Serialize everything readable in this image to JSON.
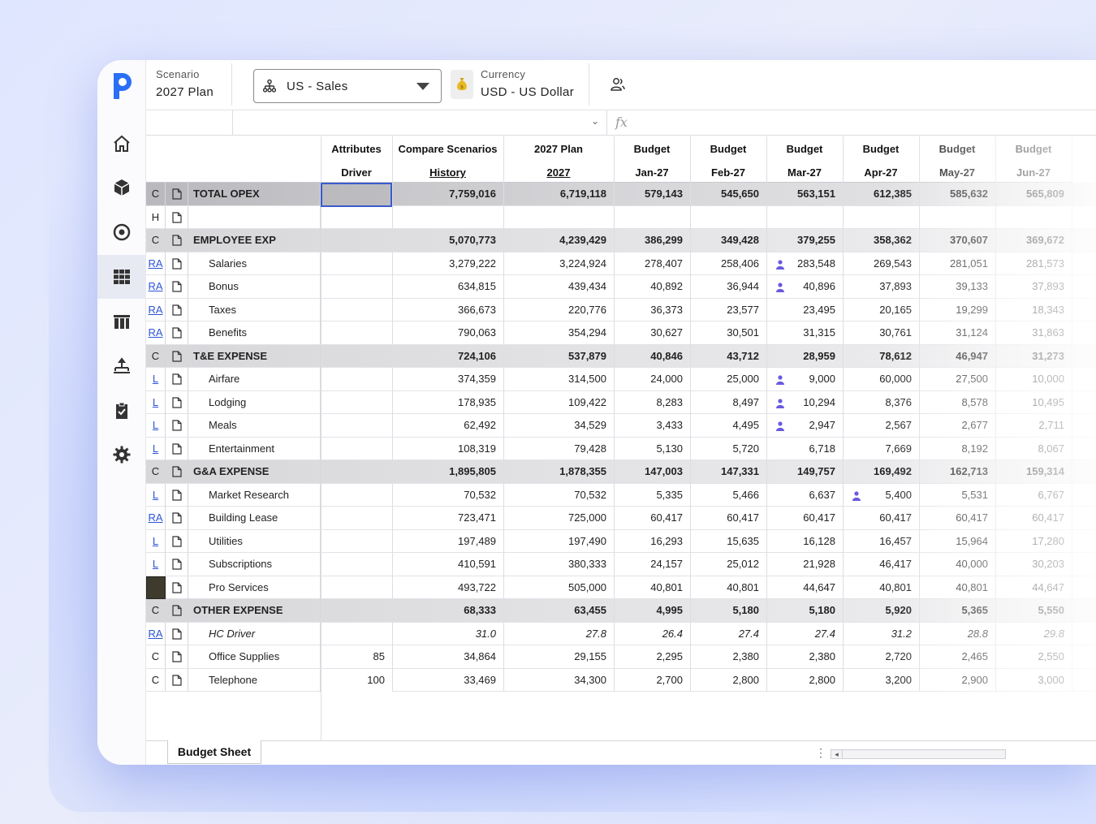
{
  "header": {
    "scenario_label": "Scenario",
    "scenario_value": "2027 Plan",
    "department_value": "US - Sales",
    "currency_label": "Currency",
    "currency_value": "USD - US Dollar"
  },
  "sheet_tab": "Budget Sheet",
  "columns": [
    {
      "top": "Attributes",
      "bottom": "Driver",
      "underline": false
    },
    {
      "top": "Compare Scenarios",
      "bottom": "History",
      "underline": true
    },
    {
      "top": "2027 Plan",
      "bottom": "2027",
      "underline": true
    },
    {
      "top": "Budget",
      "bottom": "Jan-27",
      "underline": false
    },
    {
      "top": "Budget",
      "bottom": "Feb-27",
      "underline": false
    },
    {
      "top": "Budget",
      "bottom": "Mar-27",
      "underline": false
    },
    {
      "top": "Budget",
      "bottom": "Apr-27",
      "underline": false
    },
    {
      "top": "Budget",
      "bottom": "May-27",
      "underline": false
    },
    {
      "top": "Budget",
      "bottom": "Jun-27",
      "underline": false
    }
  ],
  "rows": [
    {
      "code": "C",
      "name": "TOTAL OPEX",
      "type": "total",
      "driver": "",
      "values": [
        "7,759,016",
        "6,719,118",
        "579,143",
        "545,650",
        "563,151",
        "612,385",
        "585,632",
        "565,809"
      ]
    },
    {
      "code": "H",
      "name": "",
      "type": "blank",
      "driver": "",
      "values": [
        "",
        "",
        "",
        "",
        "",
        "",
        "",
        ""
      ]
    },
    {
      "code": "C",
      "name": "EMPLOYEE EXP",
      "type": "group",
      "driver": "",
      "values": [
        "5,070,773",
        "4,239,429",
        "386,299",
        "349,428",
        "379,255",
        "358,362",
        "370,607",
        "369,672"
      ]
    },
    {
      "code": "RA",
      "name": "Salaries",
      "type": "item",
      "driver": "",
      "values": [
        "3,279,222",
        "3,224,924",
        "278,407",
        "258,406",
        "283,548",
        "269,543",
        "281,051",
        "281,573"
      ],
      "person_col": 5
    },
    {
      "code": "RA",
      "name": "Bonus",
      "type": "item",
      "driver": "",
      "values": [
        "634,815",
        "439,434",
        "40,892",
        "36,944",
        "40,896",
        "37,893",
        "39,133",
        "37,893"
      ],
      "person_col": 5
    },
    {
      "code": "RA",
      "name": "Taxes",
      "type": "item",
      "driver": "",
      "values": [
        "366,673",
        "220,776",
        "36,373",
        "23,577",
        "23,495",
        "20,165",
        "19,299",
        "18,343"
      ]
    },
    {
      "code": "RA",
      "name": "Benefits",
      "type": "item",
      "driver": "",
      "values": [
        "790,063",
        "354,294",
        "30,627",
        "30,501",
        "31,315",
        "30,761",
        "31,124",
        "31,863"
      ]
    },
    {
      "code": "C",
      "name": "T&E EXPENSE",
      "type": "group",
      "driver": "",
      "values": [
        "724,106",
        "537,879",
        "40,846",
        "43,712",
        "28,959",
        "78,612",
        "46,947",
        "31,273"
      ]
    },
    {
      "code": "L",
      "name": "Airfare",
      "type": "item",
      "driver": "",
      "values": [
        "374,359",
        "314,500",
        "24,000",
        "25,000",
        "9,000",
        "60,000",
        "27,500",
        "10,000"
      ],
      "person_col": 5
    },
    {
      "code": "L",
      "name": "Lodging",
      "type": "item",
      "driver": "",
      "values": [
        "178,935",
        "109,422",
        "8,283",
        "8,497",
        "10,294",
        "8,376",
        "8,578",
        "10,495"
      ],
      "person_col": 5
    },
    {
      "code": "L",
      "name": "Meals",
      "type": "item",
      "driver": "",
      "values": [
        "62,492",
        "34,529",
        "3,433",
        "4,495",
        "2,947",
        "2,567",
        "2,677",
        "2,711"
      ],
      "person_col": 5
    },
    {
      "code": "L",
      "name": "Entertainment",
      "type": "item",
      "driver": "",
      "values": [
        "108,319",
        "79,428",
        "5,130",
        "5,720",
        "6,718",
        "7,669",
        "8,192",
        "8,067"
      ]
    },
    {
      "code": "C",
      "name": "G&A EXPENSE",
      "type": "group",
      "driver": "",
      "values": [
        "1,895,805",
        "1,878,355",
        "147,003",
        "147,331",
        "149,757",
        "169,492",
        "162,713",
        "159,314"
      ]
    },
    {
      "code": "L",
      "name": "Market Research",
      "type": "item",
      "driver": "",
      "values": [
        "70,532",
        "70,532",
        "5,335",
        "5,466",
        "6,637",
        "5,400",
        "5,531",
        "6,767"
      ],
      "person_col": 6
    },
    {
      "code": "RA",
      "name": "Building Lease",
      "type": "item",
      "driver": "",
      "values": [
        "723,471",
        "725,000",
        "60,417",
        "60,417",
        "60,417",
        "60,417",
        "60,417",
        "60,417"
      ]
    },
    {
      "code": "L",
      "name": "Utilities",
      "type": "item",
      "driver": "",
      "values": [
        "197,489",
        "197,490",
        "16,293",
        "15,635",
        "16,128",
        "16,457",
        "15,964",
        "17,280"
      ]
    },
    {
      "code": "L",
      "name": "Subscriptions",
      "type": "item",
      "driver": "",
      "values": [
        "410,591",
        "380,333",
        "24,157",
        "25,012",
        "21,928",
        "46,417",
        "40,000",
        "30,203"
      ]
    },
    {
      "code": "",
      "name": "Pro Services",
      "type": "item",
      "driver": "",
      "values": [
        "493,722",
        "505,000",
        "40,801",
        "40,801",
        "44,647",
        "40,801",
        "40,801",
        "44,647"
      ],
      "dark_code": true
    },
    {
      "code": "C",
      "name": "OTHER EXPENSE",
      "type": "group",
      "driver": "",
      "values": [
        "68,333",
        "63,455",
        "4,995",
        "5,180",
        "5,180",
        "5,920",
        "5,365",
        "5,550"
      ]
    },
    {
      "code": "RA",
      "name": "HC Driver",
      "type": "italic",
      "driver": "",
      "values": [
        "31.0",
        "27.8",
        "26.4",
        "27.4",
        "27.4",
        "31.2",
        "28.8",
        "29.8"
      ]
    },
    {
      "code": "C",
      "name": "Office Supplies",
      "type": "item",
      "driver": "85",
      "values": [
        "34,864",
        "29,155",
        "2,295",
        "2,380",
        "2,380",
        "2,720",
        "2,465",
        "2,550"
      ]
    },
    {
      "code": "C",
      "name": "Telephone",
      "type": "item",
      "driver": "100",
      "values": [
        "33,469",
        "34,300",
        "2,700",
        "2,800",
        "2,800",
        "3,200",
        "2,900",
        "3,000"
      ]
    }
  ],
  "colors": {
    "accent": "#2c55d8",
    "brand": "#3a5bcc",
    "person": "#6a5ae0"
  }
}
